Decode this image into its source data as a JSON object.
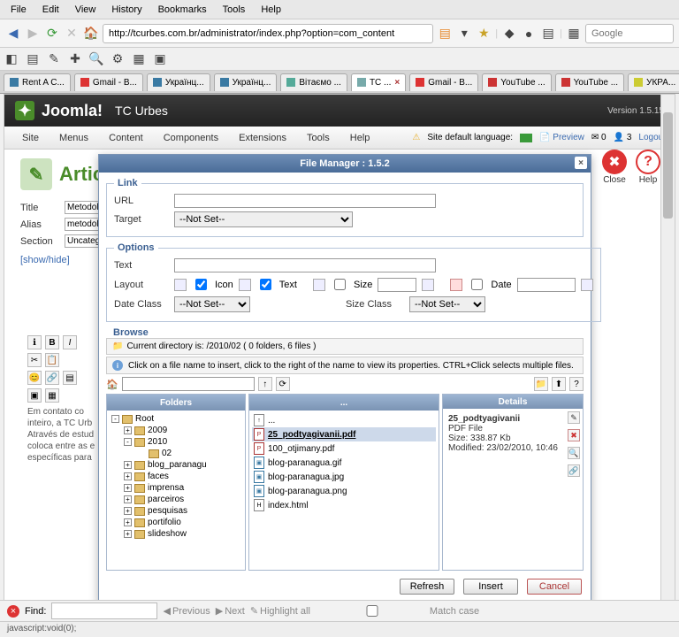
{
  "browser": {
    "menus": [
      "File",
      "Edit",
      "View",
      "History",
      "Bookmarks",
      "Tools",
      "Help"
    ],
    "url": "http://tcurbes.com.br/administrator/index.php?option=com_content",
    "search_placeholder": "Google",
    "bookmarks": [
      "Rent A C...",
      "Gmail - B...",
      "Українц...",
      "Українц...",
      "Вітаємо ...",
      "TC ...",
      "Gmail - B...",
      "YouTube ...",
      "YouTube ...",
      "УКРА..."
    ],
    "tabs": [
      "Rent A C...",
      "Gmail - B...",
      "Українц...",
      "Українц...",
      "Вітаємо ...",
      "TC ...",
      "Gmail - B...",
      "YouTube ...",
      "YouTube ...",
      "УКРА..."
    ],
    "status": "javascript:void(0);"
  },
  "findbar": {
    "label": "Find:",
    "prev": "Previous",
    "next": "Next",
    "highlight": "Highlight all",
    "matchcase": "Match case"
  },
  "joomla": {
    "brand": "Joomla!",
    "site": "TC Urbes",
    "version": "Version 1.5.15",
    "menus": [
      "Site",
      "Menus",
      "Content",
      "Components",
      "Extensions",
      "Tools",
      "Help"
    ],
    "lang_label": "Site default language:",
    "preview": "Preview",
    "msg_count": "3",
    "unread": "0",
    "logout": "Logout",
    "close": "Close",
    "help": "Help",
    "page_title": "Articl",
    "form": {
      "title_label": "Title",
      "title_value": "Metodolo",
      "alias_label": "Alias",
      "alias_value": "metodolo",
      "section_label": "Section",
      "section_value": "Uncatego"
    },
    "showhide": "[show/hide]",
    "body_text": "Em contato co inteiro, a TC Urb\n\nAtravés de estud coloca entre as e específicas para"
  },
  "dialog": {
    "title": "File Manager : 1.5.2",
    "link_legend": "Link",
    "options_legend": "Options",
    "browse_legend": "Browse",
    "url_label": "URL",
    "target_label": "Target",
    "target_value": "--Not Set--",
    "text_label": "Text",
    "layout_label": "Layout",
    "icon_label": "Icon",
    "text_chk_label": "Text",
    "size_label": "Size",
    "date_label": "Date",
    "dateclass_label": "Date Class",
    "dateclass_value": "--Not Set--",
    "sizeclass_label": "Size Class",
    "sizeclass_value": "--Not Set--",
    "currentdir": "Current directory is: /2010/02 ( 0 folders, 6 files )",
    "hint": "Click on a file name to insert, click to the right of the name to view its properties. CTRL+Click selects multiple files.",
    "folders_head": "Folders",
    "files_head": "...",
    "details_head": "Details",
    "tree": [
      {
        "label": "Root",
        "depth": 0,
        "toggle": "-"
      },
      {
        "label": "2009",
        "depth": 1,
        "toggle": "+"
      },
      {
        "label": "2010",
        "depth": 1,
        "toggle": "-"
      },
      {
        "label": "02",
        "depth": 2,
        "toggle": ""
      },
      {
        "label": "blog_paranagu",
        "depth": 1,
        "toggle": "+"
      },
      {
        "label": "faces",
        "depth": 1,
        "toggle": "+"
      },
      {
        "label": "imprensa",
        "depth": 1,
        "toggle": "+"
      },
      {
        "label": "parceiros",
        "depth": 1,
        "toggle": "+"
      },
      {
        "label": "pesquisas",
        "depth": 1,
        "toggle": "+"
      },
      {
        "label": "portifolio",
        "depth": 1,
        "toggle": "+"
      },
      {
        "label": "slideshow",
        "depth": 1,
        "toggle": "+"
      }
    ],
    "files": [
      {
        "name": "25_podtyagivanii.pdf",
        "type": "pdf",
        "selected": true
      },
      {
        "name": "100_otjimany.pdf",
        "type": "pdf",
        "selected": false
      },
      {
        "name": "blog-paranagua.gif",
        "type": "img",
        "selected": false
      },
      {
        "name": "blog-paranagua.jpg",
        "type": "img",
        "selected": false
      },
      {
        "name": "blog-paranagua.png",
        "type": "img",
        "selected": false
      },
      {
        "name": "index.html",
        "type": "html",
        "selected": false
      }
    ],
    "details": {
      "name": "25_podtyagivanii",
      "type": "PDF File",
      "size_label": "Size:",
      "size": "338.87 Kb",
      "modified_label": "Modified:",
      "modified": "23/02/2010, 10:46"
    },
    "refresh": "Refresh",
    "insert": "Insert",
    "cancel": "Cancel"
  }
}
